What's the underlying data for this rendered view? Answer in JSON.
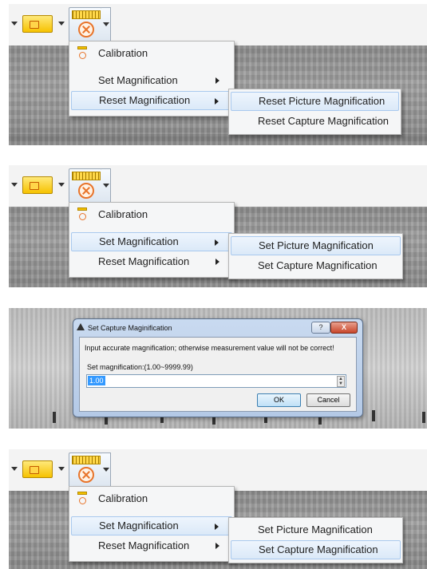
{
  "menu": {
    "calibration": "Calibration",
    "set_magnification": "Set Magnification",
    "reset_magnification": "Reset Magnification"
  },
  "reset_submenu": {
    "picture": "Reset Picture Magnification",
    "capture": "Reset Capture Magnification"
  },
  "set_submenu": {
    "picture": "Set Picture Magnification",
    "capture": "Set Capture Magnification"
  },
  "dialog": {
    "title": "Set Capture Maginification",
    "help_button": "?",
    "close_button": "X",
    "message": "Input accurate magnification; otherwise measurement value will not be correct!",
    "range_label": "Set magnification:(1.00~9999.99)",
    "input_value": "1.00",
    "ok_label": "OK",
    "cancel_label": "Cancel"
  },
  "icons": [
    "ruler-icon",
    "calibration-icon",
    "dropdown-arrow-icon",
    "submenu-arrow-icon",
    "dialog-app-icon",
    "help-icon",
    "close-icon"
  ],
  "colors": {
    "highlight": "#dbe9f8",
    "highlight_border": "#a9c9ee",
    "ruler_yellow": "#f6c200",
    "calib_orange": "#e8742a"
  }
}
